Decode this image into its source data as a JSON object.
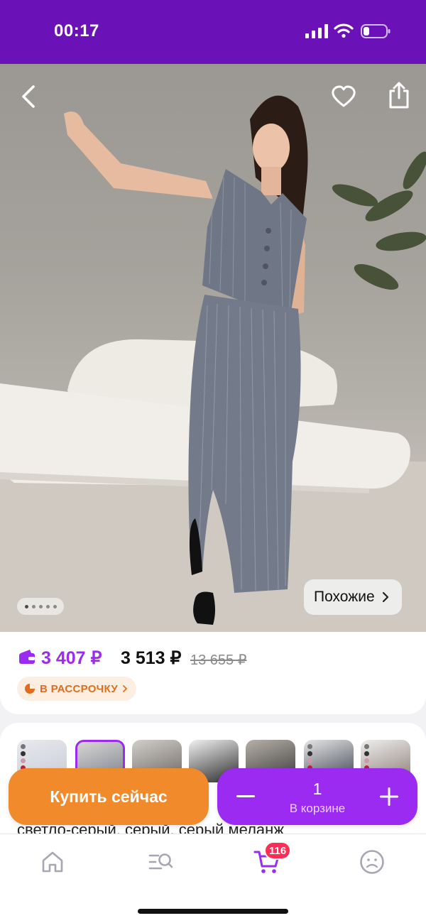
{
  "status_bar": {
    "time": "00:17",
    "background": "#6a12b8"
  },
  "hero": {
    "back_icon": "chevron-left-icon",
    "favorite_icon": "heart-icon",
    "share_icon": "share-icon",
    "similar_label": "Похожие",
    "image_count": 5,
    "active_image": 1
  },
  "price": {
    "wallet_price": "3 407 ₽",
    "price": "3 513 ₽",
    "old_price": "13 655 ₽",
    "installment_label": "В РАССРОЧКУ",
    "accent": "#9b2bf0",
    "installment_color": "#e06d1e"
  },
  "variants": {
    "thumbnails": [
      {
        "id": "v1",
        "selected": false
      },
      {
        "id": "v2",
        "selected": true
      },
      {
        "id": "v3",
        "selected": false
      },
      {
        "id": "v4",
        "selected": false
      },
      {
        "id": "v5",
        "selected": false
      },
      {
        "id": "v6",
        "selected": false
      },
      {
        "id": "v7",
        "selected": false
      }
    ],
    "colors_text": "светло-серый, серый, серый меланж"
  },
  "actions": {
    "buy_now_label": "Купить сейчас",
    "quantity": "1",
    "in_cart_label": "В корзине",
    "buy_color": "#f08a2a"
  },
  "nav": {
    "items": [
      {
        "name": "home",
        "icon": "home-icon"
      },
      {
        "name": "catalog",
        "icon": "catalog-search-icon"
      },
      {
        "name": "cart",
        "icon": "cart-icon"
      },
      {
        "name": "profile",
        "icon": "profile-icon"
      }
    ],
    "cart_badge": "116"
  }
}
